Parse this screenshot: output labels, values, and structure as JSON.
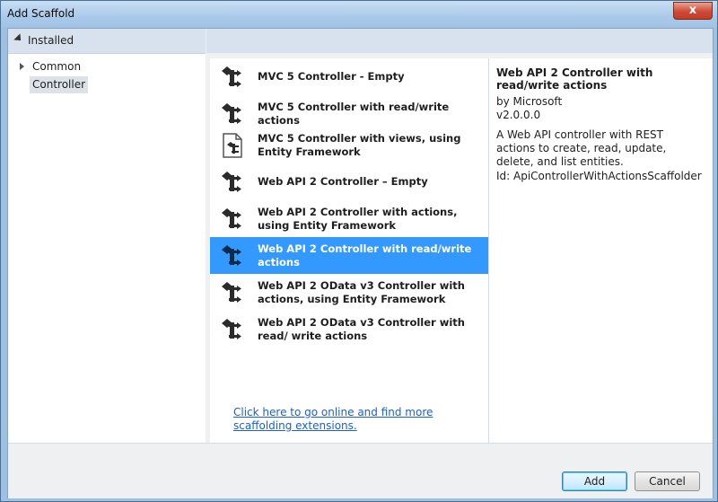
{
  "window": {
    "title": "Add Scaffold",
    "close_glyph": "x"
  },
  "left": {
    "installed_label": "Installed",
    "tree": [
      {
        "label": "Common"
      },
      {
        "label": "Controller"
      }
    ]
  },
  "items": [
    {
      "label": "MVC 5 Controller - Empty",
      "icon": "controller-icon"
    },
    {
      "label": "MVC 5 Controller with read/write actions",
      "icon": "controller-icon"
    },
    {
      "label": "MVC 5 Controller with views, using Entity Framework",
      "icon": "controller-views-icon"
    },
    {
      "label": "Web API 2 Controller – Empty",
      "icon": "controller-icon"
    },
    {
      "label": "Web API 2 Controller with actions, using Entity Framework",
      "icon": "controller-icon"
    },
    {
      "label": "Web API 2 Controller with read/write actions",
      "icon": "controller-icon",
      "selected": true
    },
    {
      "label": "Web API 2 OData v3 Controller with actions, using Entity Framework",
      "icon": "controller-icon"
    },
    {
      "label": "Web API 2 OData v3 Controller with read/ write actions",
      "icon": "controller-icon"
    }
  ],
  "more_link": "Click here to go online and find more scaffolding extensions.",
  "details": {
    "title": "Web API 2 Controller with read/write actions",
    "by": "by Microsoft",
    "version": "v2.0.0.0",
    "description": "A Web API controller with REST actions to create, read, update, delete, and list entities.",
    "id": "Id: ApiControllerWithActionsScaffolder"
  },
  "buttons": {
    "add": "Add",
    "cancel": "Cancel"
  },
  "colors": {
    "selection": "#3399ff",
    "link": "#1a5fd6"
  }
}
